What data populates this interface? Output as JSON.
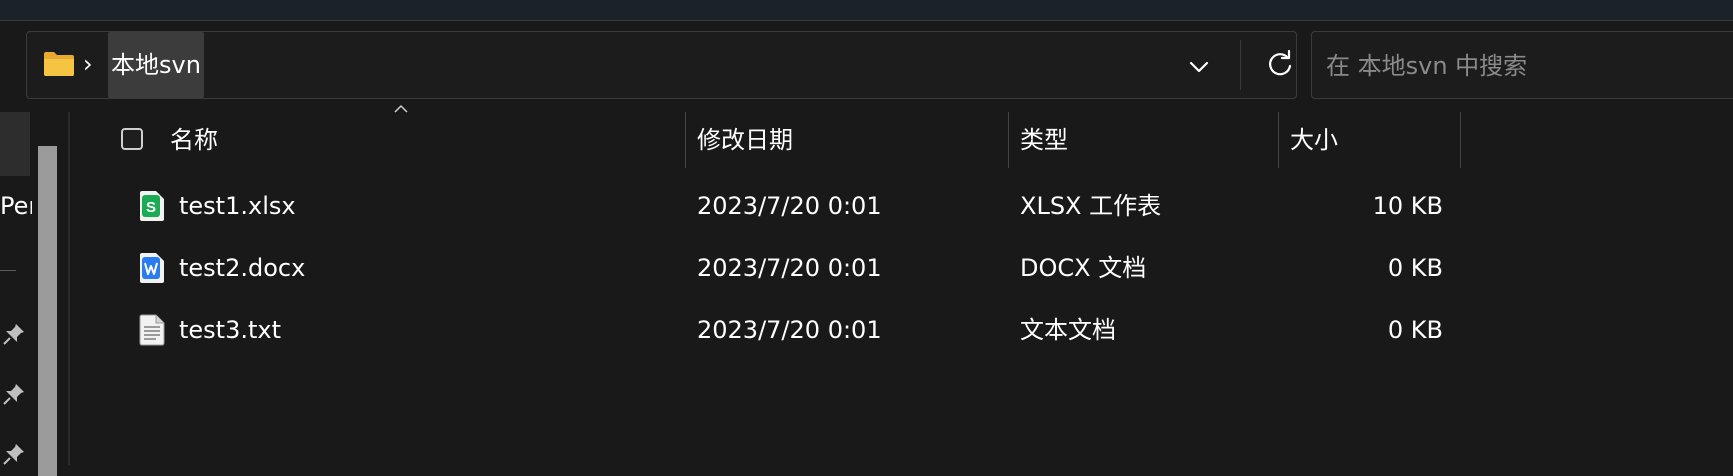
{
  "breadcrumb": {
    "folder_name": "本地svn"
  },
  "search": {
    "placeholder": "在 本地svn 中搜索"
  },
  "nav": {
    "partial_label": "Pers"
  },
  "columns": {
    "name": "名称",
    "modified": "修改日期",
    "type": "类型",
    "size": "大小"
  },
  "files": [
    {
      "name": "test1.xlsx",
      "modified": "2023/7/20 0:01",
      "type": "XLSX 工作表",
      "size": "10 KB",
      "icon": "spreadsheet-icon"
    },
    {
      "name": "test2.docx",
      "modified": "2023/7/20 0:01",
      "type": "DOCX 文档",
      "size": "0 KB",
      "icon": "word-document-icon"
    },
    {
      "name": "test3.txt",
      "modified": "2023/7/20 0:01",
      "type": "文本文档",
      "size": "0 KB",
      "icon": "text-file-icon"
    }
  ],
  "colors": {
    "background": "#191919",
    "spreadsheet": "#1bab55",
    "word": "#2b7cf0",
    "folder": "#f6c443"
  }
}
